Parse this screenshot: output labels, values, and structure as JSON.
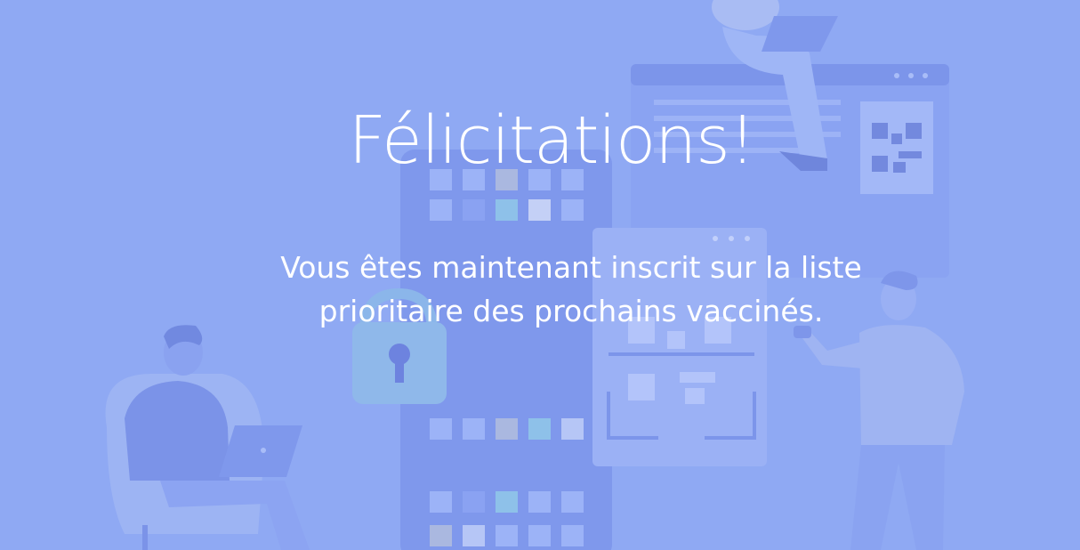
{
  "screen": {
    "title": "Félicitations!",
    "message_lines": [
      "Vous êtes maintenant inscrit sur la liste",
      "prioritaire des prochains vaccinés."
    ]
  },
  "illustration": {
    "icons": [
      "person-with-laptop-icon",
      "phone-app-grid-icon",
      "lock-icon",
      "qr-code-icon",
      "browser-window-icon",
      "person-pointing-icon",
      "person-sitting-chair-icon"
    ]
  },
  "colors": {
    "background": "#8fa9f3",
    "text": "#ffffff",
    "accent_dark": "#6b83e6",
    "accent_light": "#a9bdf8"
  }
}
